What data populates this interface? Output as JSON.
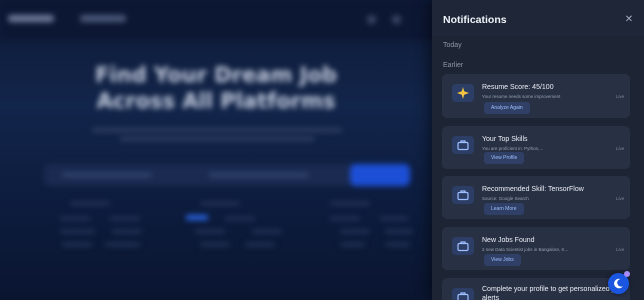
{
  "panel": {
    "title": "Notifications",
    "close_icon": "close-icon",
    "sections": {
      "today": "Today",
      "earlier": "Earlier"
    },
    "notifications": [
      {
        "icon": "sparkle-icon",
        "title": "Resume Score: 45/100",
        "desc": "Your resume needs some improvement",
        "time": "Live",
        "action": "Analyze Again"
      },
      {
        "icon": "briefcase-icon",
        "title": "Your Top Skills",
        "desc": "You are proficient in: Python,...",
        "time": "Live",
        "action": "View Profile"
      },
      {
        "icon": "briefcase-icon",
        "title": "Recommended Skill: TensorFlow",
        "desc": "Source: Google Search",
        "time": "Live",
        "action": "Learn More"
      },
      {
        "icon": "briefcase-icon",
        "title": "New Jobs Found",
        "desc": "2 new Data Scientist jobs in Bangalore, K...",
        "time": "Live",
        "action": "View Jobs"
      },
      {
        "icon": "briefcase-icon",
        "title": "Complete your profile to get personalized job alerts",
        "desc": "",
        "time": "",
        "action": ""
      }
    ]
  },
  "background": {
    "hero_title_line1": "Find Your Dream Job",
    "hero_title_line2": "Across All Platforms"
  },
  "fab": {
    "icon": "moon-icon"
  },
  "colors": {
    "accent": "#1a56e0",
    "panel_bg": "#1d2434",
    "card_bg": "#283044"
  }
}
